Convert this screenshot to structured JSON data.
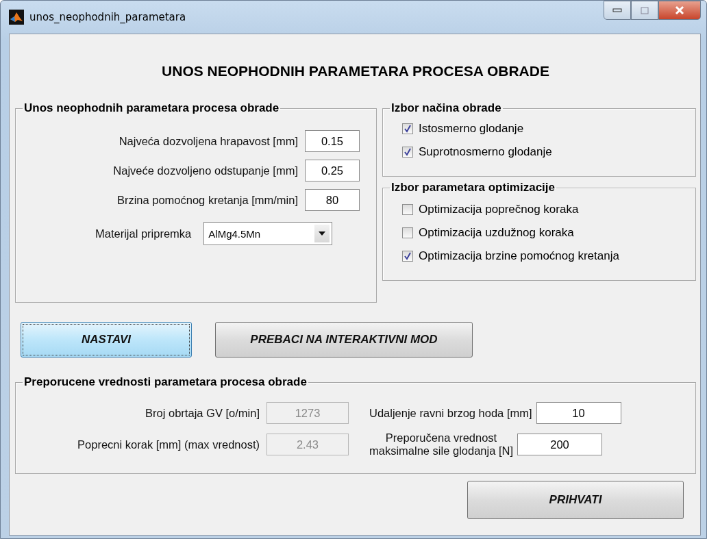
{
  "window": {
    "title": "unos_neophodnih_parametara"
  },
  "heading": "UNOS NEOPHODNIH PARAMETARA PROCESA OBRADE",
  "params_panel": {
    "title": "Unos neophodnih parametara procesa obrade",
    "fields": [
      {
        "label": "Najveća dozvoljena hrapavost [mm]",
        "value": "0.15"
      },
      {
        "label": "Najveće dozvoljeno odstupanje [mm]",
        "value": "0.25"
      },
      {
        "label": "Brzina pomoćnog kretanja [mm/min]",
        "value": "80"
      }
    ],
    "material": {
      "label": "Materijal pripremka",
      "value": "AlMg4.5Mn"
    }
  },
  "mode_panel": {
    "title": "Izbor načina obrade",
    "options": [
      {
        "label": "Istosmerno glodanje",
        "checked": true
      },
      {
        "label": "Suprotnosmerno glodanje",
        "checked": true
      }
    ]
  },
  "optimization_panel": {
    "title": "Izbor parametara optimizacije",
    "options": [
      {
        "label": "Optimizacija poprečnog koraka",
        "checked": false
      },
      {
        "label": "Optimizacija uzdužnog koraka",
        "checked": false
      },
      {
        "label": "Optimizacija brzine pomoćnog kretanja",
        "checked": true
      }
    ]
  },
  "buttons": [
    {
      "label": "NASTAVI",
      "focused": true
    },
    {
      "label": "PREBACI NA INTERAKTIVNI MOD",
      "focused": false
    }
  ],
  "recommended_panel": {
    "title": "Preporucene vrednosti parametara procesa obrade",
    "left_fields": [
      {
        "label": "Broj obrtaja GV [o/min]",
        "value": "1273",
        "disabled": true
      },
      {
        "label": "Poprecni korak  [mm] (max vrednost)",
        "value": "2.43",
        "disabled": true
      }
    ],
    "right_fields": [
      {
        "label": "Udaljenje ravni brzog hoda [mm]",
        "value": "10",
        "disabled": false
      },
      {
        "label": "Preporučena vrednost\nmaksimalne sile glodanja [N]",
        "value": "200",
        "disabled": false
      }
    ]
  },
  "accept_button": {
    "label": "PRIHVATI"
  }
}
